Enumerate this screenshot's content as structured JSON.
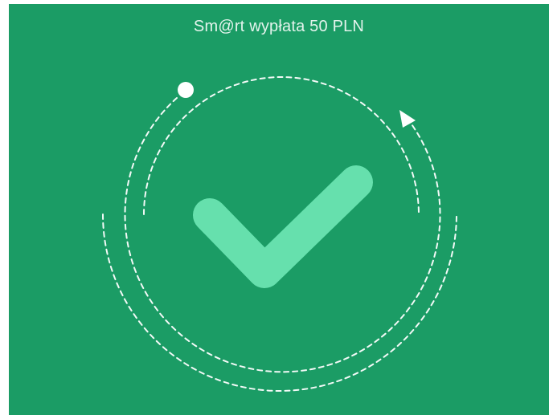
{
  "screen": {
    "title": "Sm@rt wypłata 50 PLN",
    "status": "success"
  },
  "graphic": {
    "icon": "checkmark-icon",
    "icon_color": "#66e0ad",
    "ring_color": "#ffffff",
    "background_color": "#1b9c65"
  }
}
